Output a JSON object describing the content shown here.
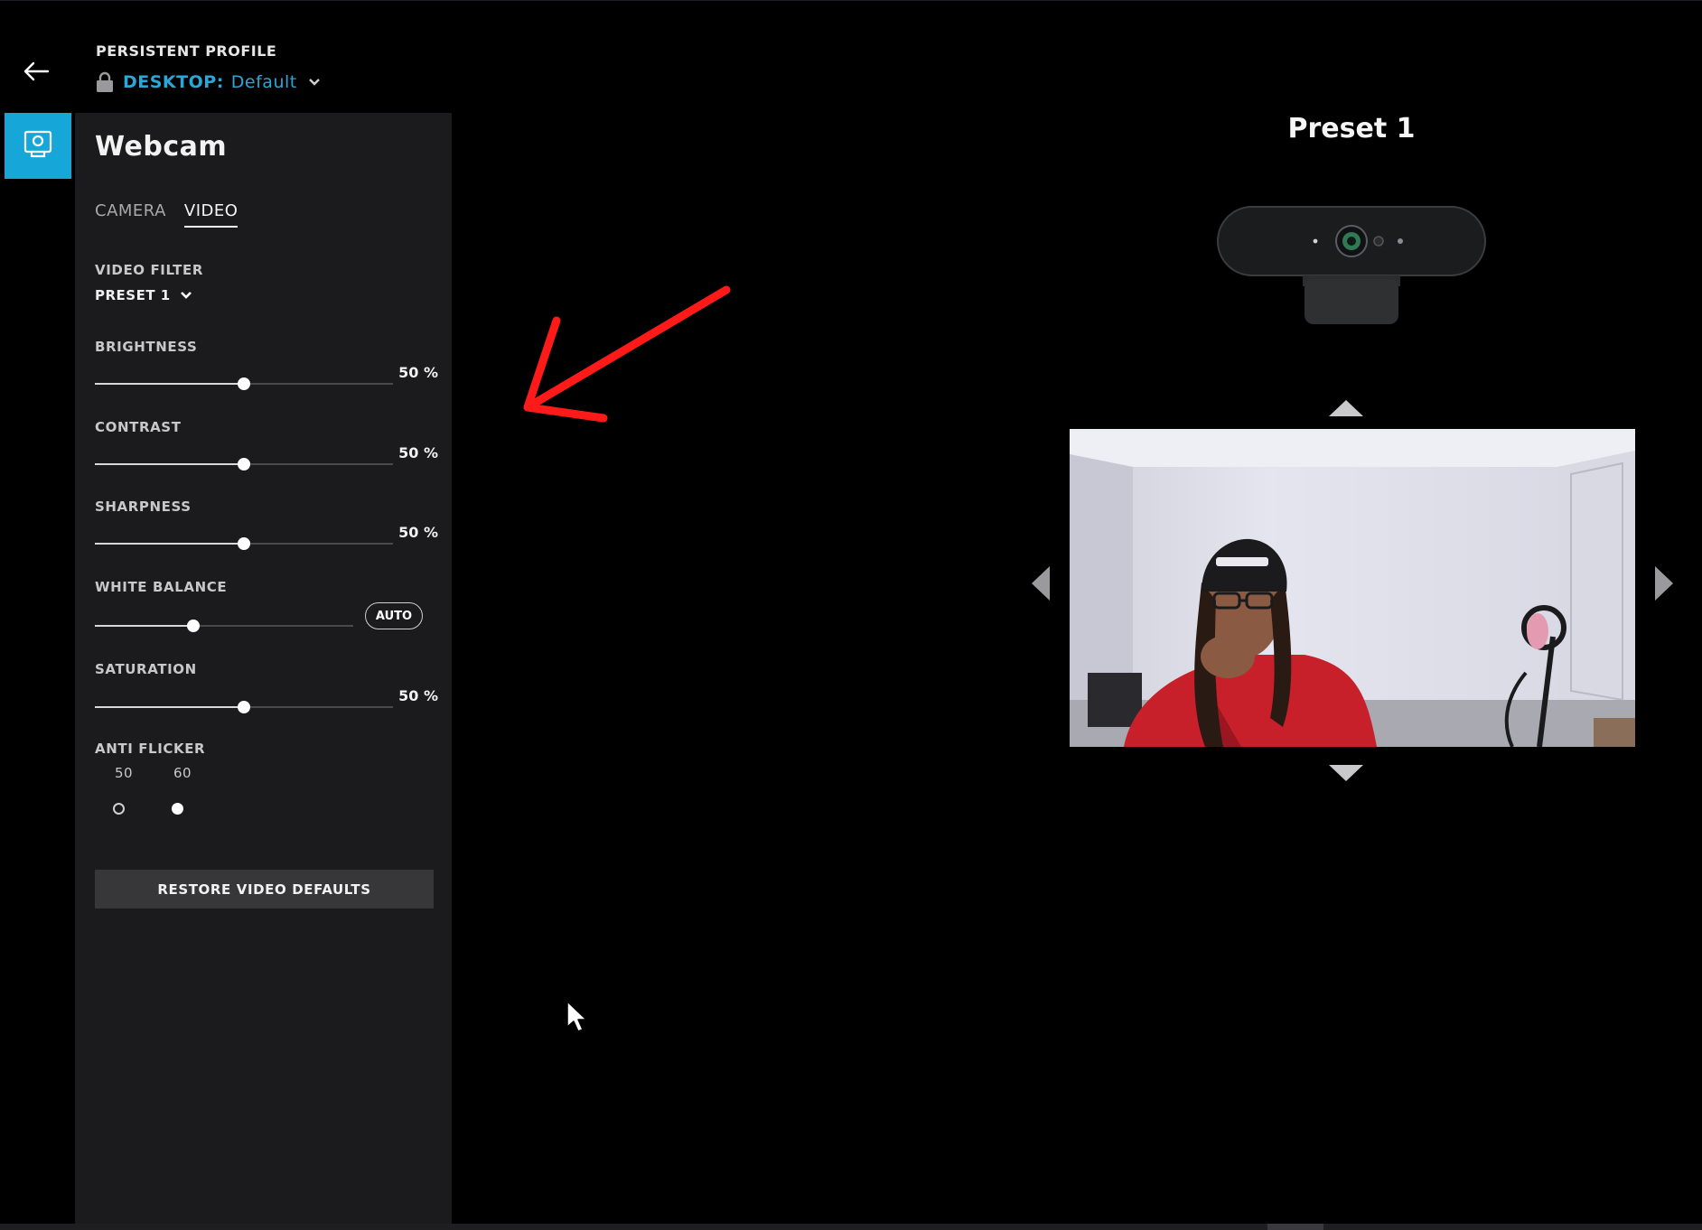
{
  "header": {
    "profile_caption": "PERSISTENT PROFILE",
    "profile_key": "DESKTOP:",
    "profile_value": "Default"
  },
  "panel": {
    "title": "Webcam",
    "tabs": [
      {
        "label": "CAMERA",
        "active": false
      },
      {
        "label": "VIDEO",
        "active": true
      }
    ],
    "video_filter": {
      "label": "VIDEO FILTER",
      "selected": "PRESET 1"
    },
    "brightness": {
      "label": "BRIGHTNESS",
      "value": 50,
      "display": "50 %"
    },
    "contrast": {
      "label": "CONTRAST",
      "value": 50,
      "display": "50 %"
    },
    "sharpness": {
      "label": "SHARPNESS",
      "value": 50,
      "display": "50 %"
    },
    "white_balance": {
      "label": "WHITE BALANCE",
      "value": 38,
      "auto_label": "AUTO"
    },
    "saturation": {
      "label": "SATURATION",
      "value": 50,
      "display": "50 %"
    },
    "anti_flicker": {
      "label": "ANTI FLICKER",
      "options": [
        {
          "label": "50",
          "selected": false
        },
        {
          "label": "60",
          "selected": true
        }
      ]
    },
    "restore_label": "RESTORE VIDEO DEFAULTS"
  },
  "preview": {
    "title": "Preset 1"
  },
  "colors": {
    "accent": "#16a7d8",
    "profile_link": "#2aa6d9",
    "panel_bg": "#1b1b1d",
    "annotation_arrow": "#ff1a1a"
  },
  "icons": {
    "back": "arrow-left-icon",
    "lock": "lock-icon",
    "webcam_nav": "webcam-icon"
  }
}
